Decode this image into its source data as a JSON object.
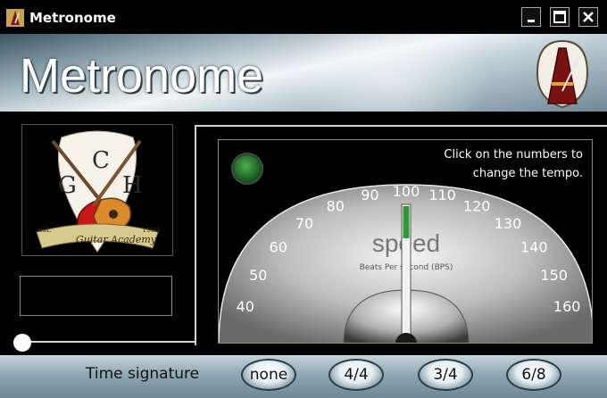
{
  "window": {
    "title": "Metronome"
  },
  "header": {
    "heading": "Metronome"
  },
  "hint": {
    "line1": "Click on the numbers to",
    "line2": "change the tempo."
  },
  "gauge": {
    "ticks": [
      "40",
      "50",
      "60",
      "70",
      "80",
      "90",
      "100",
      "110",
      "120",
      "130",
      "140",
      "150",
      "160"
    ],
    "label_big": "speed",
    "label_small": "Beats Per second (BPS)",
    "current": 100
  },
  "logo": {
    "letters": [
      "G",
      "C",
      "H"
    ],
    "banner": "Guitar Academy",
    "est": "est.",
    "year": "1993"
  },
  "footer": {
    "time_signature_label": "Time signature",
    "options": [
      "none",
      "4/4",
      "3/4",
      "6/8"
    ]
  },
  "colors": {
    "accent_green": "#4caf50",
    "header_steel": "#8ba2ad"
  }
}
